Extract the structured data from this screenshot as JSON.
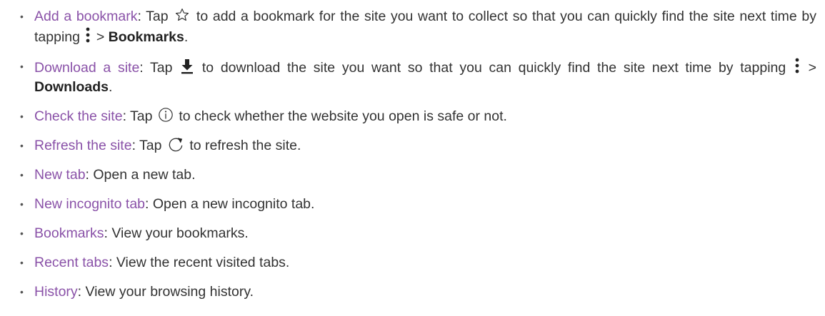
{
  "items": [
    {
      "term": "Add a bookmark",
      "p1": ": Tap ",
      "icon1": "star-outline-icon",
      "p2": " to add a bookmark for the site you want to collect so that you can quickly find the site next time by tapping ",
      "icon2": "more-vertical-icon",
      "p3": " > ",
      "bold": "Bookmarks",
      "p4": "."
    },
    {
      "term": "Download a site",
      "p1": ": Tap ",
      "icon1": "download-icon",
      "p2": " to download the site you want so that you can quickly find the site next time by tapping ",
      "icon2": "more-vertical-icon",
      "p3": " > ",
      "bold": "Downloads",
      "p4": "."
    },
    {
      "term": "Check the site",
      "p1": ": Tap ",
      "icon1": "info-circle-icon",
      "p2": " to check whether the website you open is safe or not."
    },
    {
      "term": "Refresh the site",
      "p1": ": Tap ",
      "icon1": "refresh-icon",
      "p2": " to refresh the site."
    },
    {
      "term": "New tab",
      "p1": ": Open a new tab."
    },
    {
      "term": "New incognito tab",
      "p1": ": Open a new incognito tab."
    },
    {
      "term": "Bookmarks",
      "p1": ": View your bookmarks."
    },
    {
      "term": "Recent tabs",
      "p1": ": View the recent visited tabs."
    },
    {
      "term": "History",
      "p1": ": View your browsing history."
    }
  ],
  "colors": {
    "term": "#8a52a8",
    "text": "#333333"
  }
}
